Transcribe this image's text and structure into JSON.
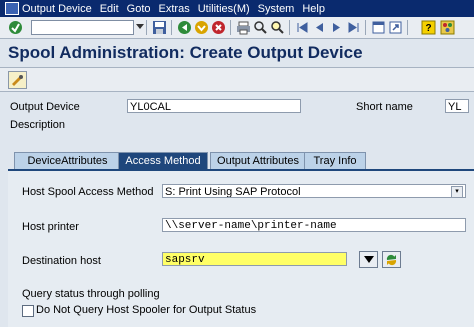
{
  "menubar": {
    "items": [
      "Output Device",
      "Edit",
      "Goto",
      "Extras",
      "Utilities(M)",
      "System",
      "Help"
    ]
  },
  "toolbar": {
    "command_field_value": "",
    "icons": [
      "enter-icon",
      "save-icon",
      "back-icon",
      "exit-icon",
      "cancel-icon",
      "print-icon",
      "find-icon",
      "find-next-icon",
      "first-page-icon",
      "previous-page-icon",
      "next-page-icon",
      "last-page-icon",
      "create-session-icon",
      "shortcut-icon",
      "help-icon",
      "layout-icon"
    ]
  },
  "title": "Spool Administration: Create Output Device",
  "header": {
    "output_device_label": "Output Device",
    "output_device_value": "YL0CAL",
    "short_name_label": "Short name",
    "short_name_value": "YL",
    "description_label": "Description"
  },
  "tabs": [
    {
      "label": "DeviceAttributes",
      "active": false
    },
    {
      "label": "Access Method",
      "active": true
    },
    {
      "label": "Output Attributes",
      "active": false
    },
    {
      "label": "Tray Info",
      "active": false
    }
  ],
  "access_method": {
    "host_spool_label": "Host Spool Access Method",
    "host_spool_value": "S: Print Using SAP Protocol",
    "host_printer_label": "Host printer",
    "host_printer_value": "\\\\server-name\\printer-name",
    "destination_host_label": "Destination host",
    "destination_host_value": "sapsrv",
    "query_status_label": "Query status through polling",
    "no_query_label": "Do Not Query Host Spooler for Output Status",
    "no_query_checked": false
  },
  "colors": {
    "menubar_bg": "#0a2a6e",
    "title_text": "#112b5f",
    "active_tab": "#1f477c",
    "inactive_tab": "#bcd2e8",
    "highlight_field": "#ffff66"
  }
}
